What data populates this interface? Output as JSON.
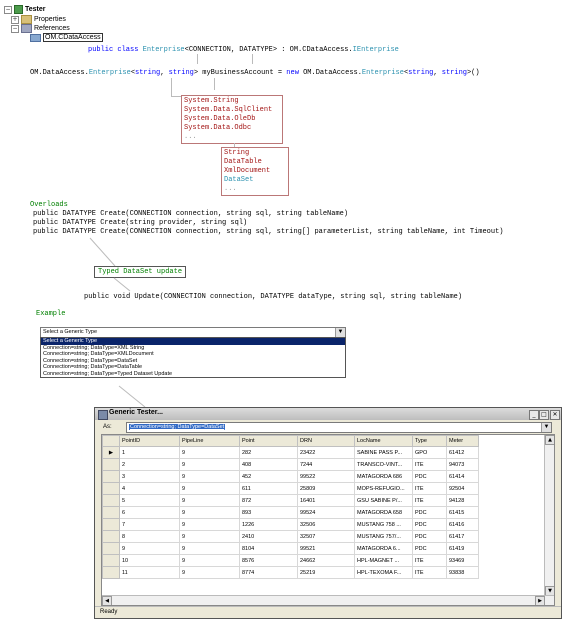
{
  "tree": {
    "root": "Tester",
    "properties": "Properties",
    "references": "References",
    "dll": "OM.CDataAccess"
  },
  "code": {
    "class_line": {
      "kw1": "public class",
      "name": "Enterprise",
      "generics": "<CONNECTION, DATATYPE> : OM.CDataAccess.",
      "iface": "IEnterprise"
    },
    "decl_line": {
      "ns1": "OM.DataAccess.",
      "t1": "Enterprise",
      "g1": "<",
      "k1": "string",
      "c1": ", ",
      "k2": "string",
      "g2": "> myBusinessAccount = ",
      "kw_new": "new",
      "ns2": " OM.DataAccess.",
      "t2": "Enterprise",
      "g3": "<",
      "k3": "string",
      "c2": ", ",
      "k4": "string",
      "g4": ">()"
    },
    "connection_types": [
      "System.String",
      "System.Data.SqlClient",
      "System.Data.OleDb",
      "System.Data.Odbc",
      "..."
    ],
    "data_types": [
      "String",
      "DataTable",
      "XmlDocument",
      "DataSet",
      "..."
    ],
    "overloads_label": "Overloads",
    "overloads": [
      "public DATATYPE Create(CONNECTION connection, string sql, string tableName)",
      "public DATATYPE Create(string provider, string sql)",
      "public DATATYPE Create(CONNECTION connection, string sql, string[] parameterList, string tableName, int Timeout)"
    ],
    "typed_label": "Typed DataSet update",
    "update_line": "public void Update(CONNECTION connection, DATATYPE dataType, string sql, string tableName)",
    "example_label": "Example"
  },
  "dropdown": {
    "selected": "Select a Generic Type",
    "arrow": "▼",
    "options": [
      "Select a Generic Type",
      "Connection=string; DataType=XML String",
      "Connection=string; DataType=XMLDocument",
      "Connection=string; DataType=DataSet",
      "Connection=string; DataType=DataTable",
      "Connection=string; DataType=Typed Dataset Update"
    ]
  },
  "window": {
    "title": "Generic Tester...",
    "as_label": "As:",
    "as_value": "Connection=string; DataType=DataSet",
    "min": "_",
    "max": "□",
    "close": "✕",
    "status": "Ready",
    "columns": [
      "PointID",
      "PipeLine",
      "Point",
      "DRN",
      "LocName",
      "Type",
      "Meter"
    ],
    "rows": [
      [
        "1",
        "9",
        "282",
        "23422",
        "SABINE PASS P...",
        "GPO",
        "61412"
      ],
      [
        "2",
        "9",
        "408",
        "7244",
        "TRANSCO-VINT...",
        "ITE",
        "94073"
      ],
      [
        "3",
        "9",
        "452",
        "99522",
        "MATAGORDA 686",
        "PDC",
        "61414"
      ],
      [
        "4",
        "9",
        "611",
        "25809",
        "MOPS-REFUGIO...",
        "ITE",
        "92504"
      ],
      [
        "5",
        "9",
        "872",
        "16401",
        "GSU SABINE P/...",
        "ITE",
        "94128"
      ],
      [
        "6",
        "9",
        "893",
        "99524",
        "MATAGORDA 658",
        "PDC",
        "61415"
      ],
      [
        "7",
        "9",
        "1226",
        "32506",
        "MUSTANG 758 ...",
        "PDC",
        "61416"
      ],
      [
        "8",
        "9",
        "2410",
        "32507",
        "MUSTANG 757/...",
        "PDC",
        "61417"
      ],
      [
        "9",
        "9",
        "8104",
        "99521",
        "MATAGORDA 6...",
        "PDC",
        "61419"
      ],
      [
        "10",
        "9",
        "8576",
        "24662",
        "HPL-MAGNET ...",
        "ITE",
        "93469"
      ],
      [
        "11",
        "9",
        "8774",
        "25219",
        "HPL-TEXOMA F...",
        "ITE",
        "93838"
      ]
    ],
    "current_row_marker": "▶"
  }
}
